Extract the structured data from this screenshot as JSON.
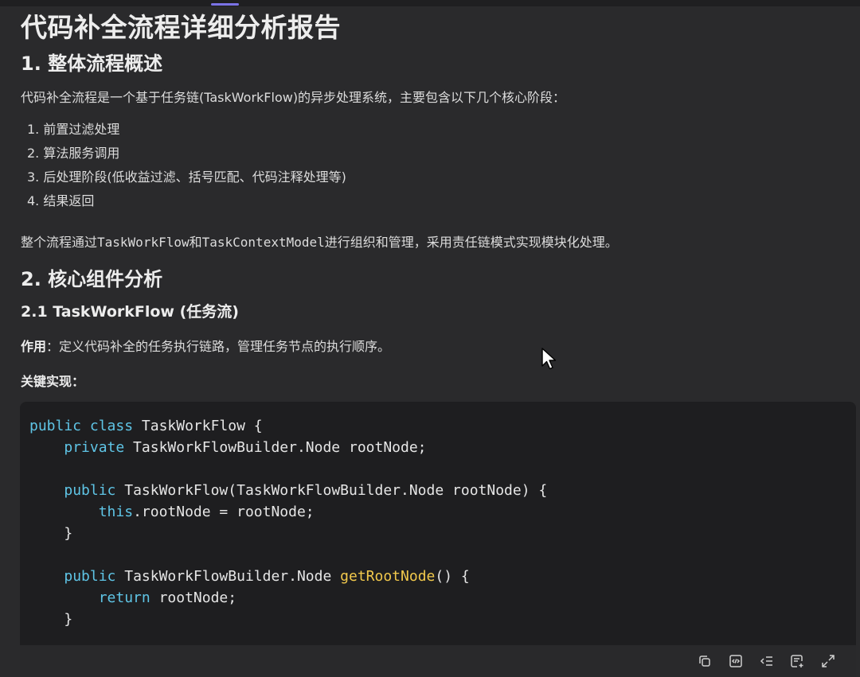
{
  "doc": {
    "title": "代码补全流程详细分析报告",
    "section1": {
      "heading": "1. 整体流程概述",
      "intro": "代码补全流程是一个基于任务链(TaskWorkFlow)的异步处理系统，主要包含以下几个核心阶段：",
      "steps": [
        "1. 前置过滤处理",
        "2. 算法服务调用",
        "3. 后处理阶段(低收益过滤、括号匹配、代码注释处理等)",
        "4. 结果返回"
      ],
      "summary_prefix": "整个流程通过",
      "summary_code1": "TaskWorkFlow",
      "summary_mid": "和",
      "summary_code2": "TaskContextModel",
      "summary_suffix": "进行组织和管理，采用责任链模式实现模块化处理。"
    },
    "section2": {
      "heading": "2. 核心组件分析",
      "subheading": "2.1 TaskWorkFlow (任务流)",
      "role_label": "作用",
      "role_text": "：定义代码补全的任务执行链路，管理任务节点的执行顺序。",
      "key_impl_label": "关键实现：",
      "code_lines": [
        [
          {
            "t": "public",
            "c": "kw"
          },
          {
            "t": " "
          },
          {
            "t": "class",
            "c": "kw"
          },
          {
            "t": " TaskWorkFlow {"
          }
        ],
        [
          {
            "t": "    "
          },
          {
            "t": "private",
            "c": "kw"
          },
          {
            "t": " TaskWorkFlowBuilder.Node rootNode;"
          }
        ],
        [
          {
            "t": ""
          }
        ],
        [
          {
            "t": "    "
          },
          {
            "t": "public",
            "c": "kw"
          },
          {
            "t": " TaskWorkFlow(TaskWorkFlowBuilder.Node rootNode) {"
          }
        ],
        [
          {
            "t": "        "
          },
          {
            "t": "this",
            "c": "kw"
          },
          {
            "t": ".rootNode = rootNode;"
          }
        ],
        [
          {
            "t": "    }"
          }
        ],
        [
          {
            "t": ""
          }
        ],
        [
          {
            "t": "    "
          },
          {
            "t": "public",
            "c": "kw"
          },
          {
            "t": " TaskWorkFlowBuilder.Node "
          },
          {
            "t": "getRootNode",
            "c": "fn"
          },
          {
            "t": "() {"
          }
        ],
        [
          {
            "t": "        "
          },
          {
            "t": "return",
            "c": "kw"
          },
          {
            "t": " rootNode;"
          }
        ],
        [
          {
            "t": "    }"
          }
        ]
      ]
    }
  },
  "code_toolbar": {
    "buttons": [
      "copy-icon",
      "code-icon",
      "indent-icon",
      "insert-icon",
      "expand-icon"
    ]
  },
  "colors": {
    "background": "#2a2a2c",
    "code_background": "#1e1e20",
    "keyword": "#5fc5e6",
    "function": "#f2c94c",
    "accent": "#7b73e6"
  }
}
